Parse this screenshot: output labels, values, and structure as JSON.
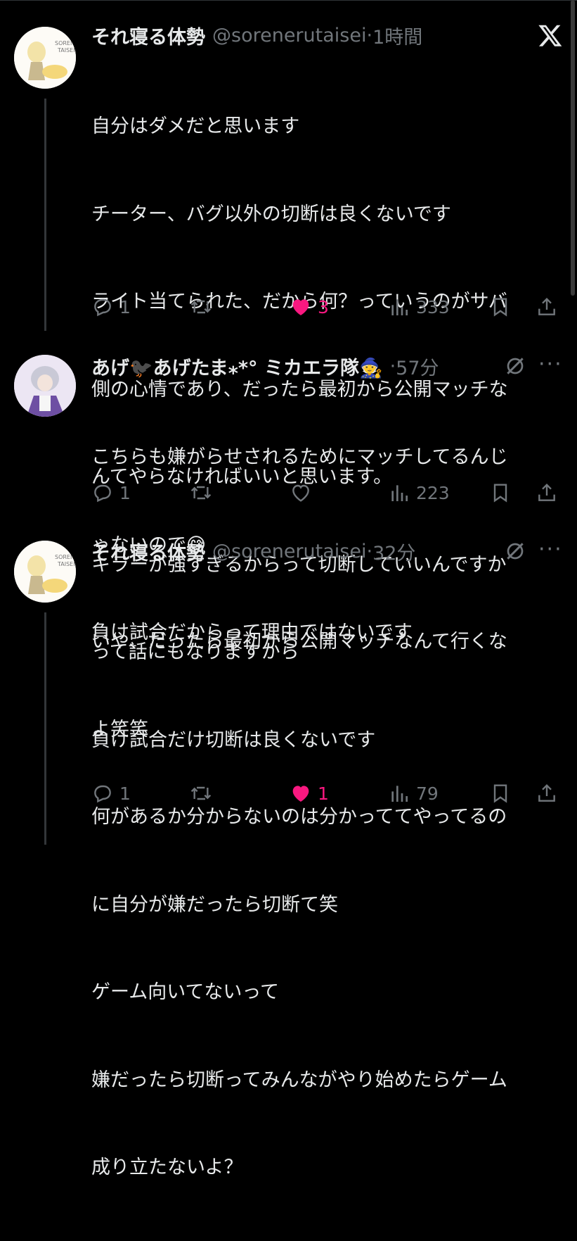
{
  "tweets": [
    {
      "name": "それ寝る体勢",
      "handle": "@sorenerutaisei",
      "time": "1時間",
      "lines": [
        "自分はダメだと思います",
        "チーター、バグ以外の切断は良くないです",
        "ライト当てられた、だから何？っていうのがサバ",
        "側の心情であり、だったら最初から公開マッチな",
        "んてやらなければいいと思います。",
        "キラーが強すぎるからって切断していいんですか",
        "って話にもなりますから",
        "負け試合だけ切断は良くないです"
      ],
      "replies": "1",
      "retweets": "",
      "likes": "3",
      "views": "333",
      "liked": true
    },
    {
      "name": "あげ🐦‍⬛あげたま⁎*° ミカエラ隊🧙",
      "handle": "",
      "time": "57分",
      "lines": [
        "こちらも嫌がらせされるためにマッチしてるんじ",
        "ゃないので😅",
        "負け試合だからって理由ではないです"
      ],
      "replies": "1",
      "retweets": "",
      "likes": "",
      "views": "223",
      "liked": false
    },
    {
      "name": "それ寝る体勢",
      "handle": "@sorenerutaisei",
      "time": "32分",
      "lines": [
        "いや、だったら最初から公開マッチなんて行くな",
        "よ笑笑",
        "何があるか分からないのは分かっててやってるの",
        "に自分が嫌だったら切断て笑",
        "ゲーム向いてないって",
        "嫌だったら切断ってみんながやり始めたらゲーム",
        "成り立たないよ？"
      ],
      "replies": "1",
      "retweets": "",
      "likes": "1",
      "views": "79",
      "liked": true
    }
  ],
  "dot_sep": "·",
  "icons": {
    "reply": "reply-icon",
    "retweet": "retweet-icon",
    "like": "heart-icon",
    "views": "views-icon",
    "bookmark": "bookmark-icon",
    "share": "share-icon",
    "brand": "x-logo-icon",
    "grok": "grok-icon",
    "more": "more-icon"
  },
  "colors": {
    "background": "#000000",
    "text": "#e7e9ea",
    "secondary": "#71767b",
    "like": "#f91880"
  }
}
